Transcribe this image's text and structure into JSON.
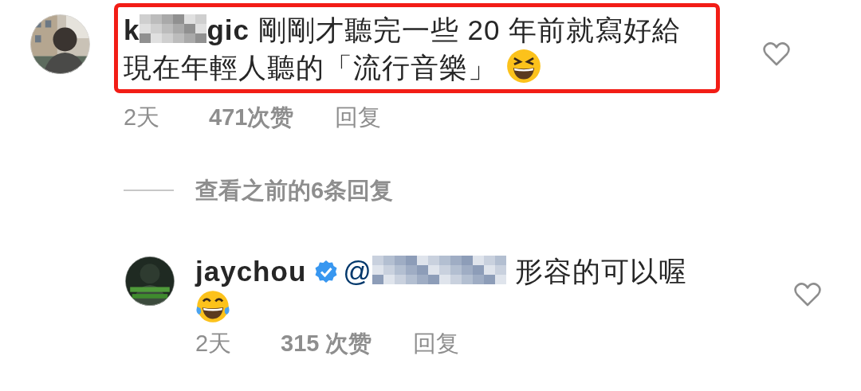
{
  "comment": {
    "username_visible_start": "k",
    "username_visible_end": "gic",
    "username_blurred": true,
    "text_lines": [
      "剛剛才聽完一些 20 年前就寫好給",
      "現在年輕人聽的「流行音樂」"
    ],
    "highlighted": true,
    "liked": false,
    "time": "2天",
    "likes": "471次赞",
    "reply_action": "回复"
  },
  "view_replies": "查看之前的6条回复",
  "reply": {
    "username": "jaychou",
    "verified": true,
    "mention_prefix": "@",
    "mention_blurred": true,
    "text": "形容的可以喔",
    "liked": false,
    "time": "2天",
    "likes": "315 次赞",
    "reply_action": "回复"
  }
}
